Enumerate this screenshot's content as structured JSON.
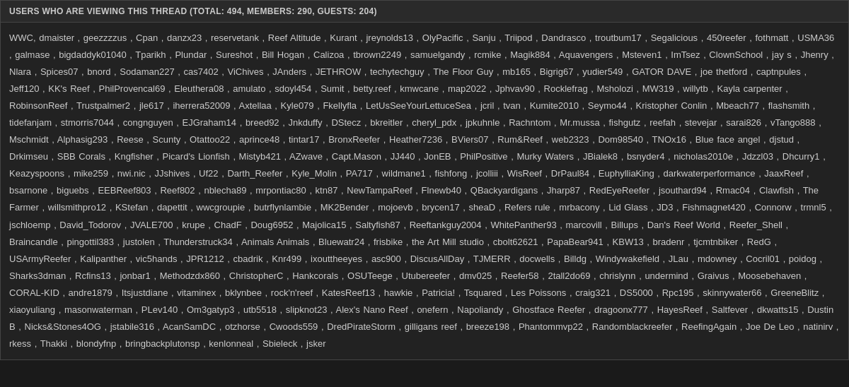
{
  "header": {
    "title": "USERS WHO ARE VIEWING THIS THREAD (TOTAL: 494, MEMBERS: 290, GUESTS: 204)"
  },
  "content": {
    "html": "content-area"
  }
}
